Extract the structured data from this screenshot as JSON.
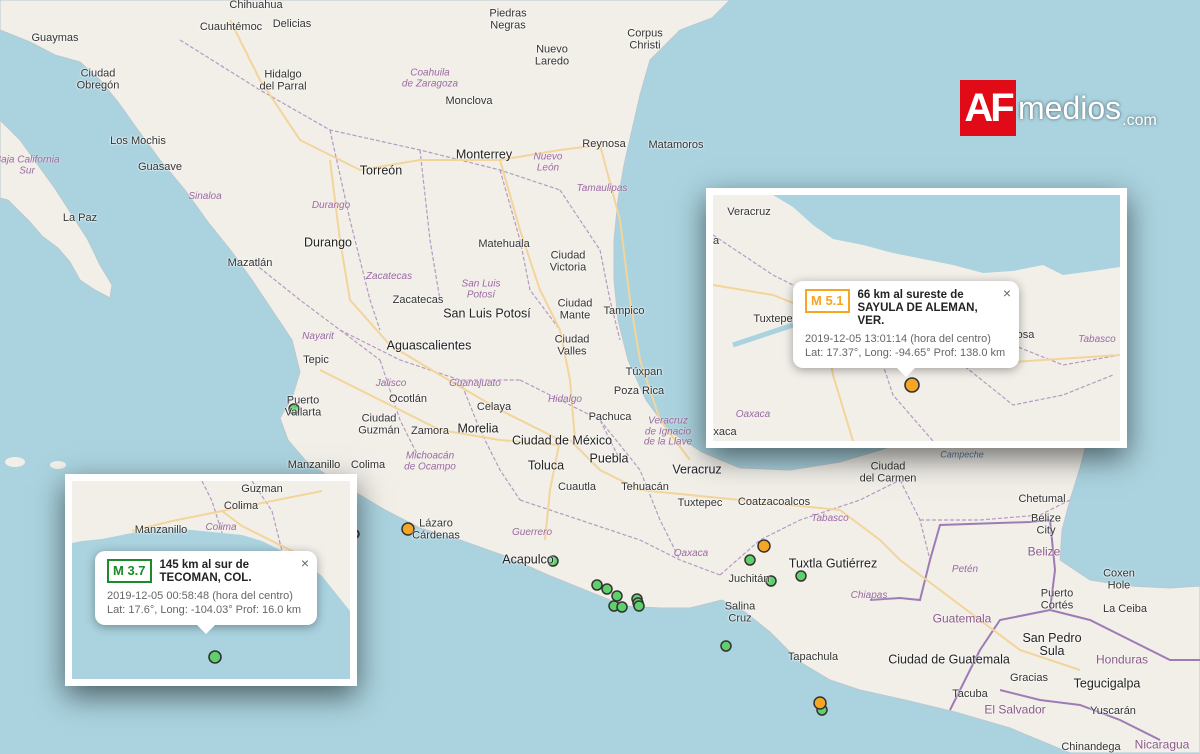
{
  "colors": {
    "water": "#aad3df",
    "land": "#f2efe9",
    "border": "#b49bc2",
    "road": "#f3d49a",
    "quake_green": "#5fd06b",
    "quake_orange": "#f5a623",
    "brand_red": "#e10b17"
  },
  "logo": {
    "box_text": "AF",
    "name": "medios",
    "suffix": ".com"
  },
  "labels": {
    "chihuahua": "Chihuahua",
    "guaymas": "Guaymas",
    "cuauhtemoc": "Cuauhtémoc",
    "delicias": "Delicias",
    "piedras_negras": "Piedras\nNegras",
    "corpus_christi": "Corpus\nChristi",
    "ciudad_obregon": "Ciudad\nObregón",
    "hidalgo_parral": "Hidalgo\ndel Parral",
    "coahuila": "Coahuila\nde Zaragoza",
    "nuevo_laredo": "Nuevo\nLaredo",
    "monclova": "Monclova",
    "los_mochis": "Los Mochis",
    "guasave": "Guasave",
    "baja_california_sur": "Baja California\nSur",
    "torreon": "Torreón",
    "monterrey": "Monterrey",
    "nuevo_leon": "Nuevo\nLeón",
    "reynosa": "Reynosa",
    "matamoros": "Matamoros",
    "sinaloa": "Sinaloa",
    "durango_state": "Durango",
    "tamaulipas": "Tamaulipas",
    "la_paz": "La Paz",
    "durango": "Durango",
    "matehuala": "Matehuala",
    "ciudad_victoria": "Ciudad\nVictoria",
    "mazatlan": "Mazatlán",
    "zacatecas_state": "Zacatecas",
    "san_luis_potosi_state": "San Luis\nPotosí",
    "zacatecas": "Zacatecas",
    "ciudad_mante": "Ciudad\nMante",
    "san_luis_potosi": "San Luis Potosí",
    "tampico": "Tampico",
    "nayarit": "Nayarit",
    "aguascalientes": "Aguascalientes",
    "ciudad_valles": "Ciudad\nValles",
    "tepic": "Tepic",
    "jalisco": "Jalisco",
    "guanajuato": "Guanajuato",
    "tuxpan": "Túxpan",
    "puerto_vallarta": "Puerto\nVallarta",
    "ocotlan": "Ocotlán",
    "hidalgo_state": "Hidalgo",
    "poza_rica": "Poza Rica",
    "celaya": "Celaya",
    "pachuca": "Pachuca",
    "ciudad_guzman": "Ciudad\nGuzmán",
    "zamora": "Zamora",
    "morelia": "Morelia",
    "veracruz_state": "Veracruz\nde Ignacio\nde la Llave",
    "ciudad_de_mexico": "Ciudad de México",
    "manzanillo": "Manzanillo",
    "colima": "Colima",
    "michoacan": "Michoacán\nde Ocampo",
    "toluca": "Toluca",
    "puebla": "Puebla",
    "veracruz": "Veracruz",
    "cuautla": "Cuautla",
    "tehuacan": "Tehuacán",
    "lazaro_cardenas": "Lázaro\nCárdenas",
    "coatzacoalcos": "Coatzacoalcos",
    "tuxtepec": "Tuxtepec",
    "guerrero": "Guerrero",
    "tabasco_state": "Tabasco",
    "acapulco": "Acapulco",
    "oaxaca_state": "Oaxaca",
    "juchitan": "Juchitán",
    "tuxtla_gutierrez": "Tuxtla Gutiérrez",
    "salina_cruz": "Salina\nCruz",
    "chiapas": "Chiapas",
    "tapachula": "Tapachula",
    "ciudad_guatemala": "Ciudad de Guatemala",
    "guatemala": "Guatemala",
    "honduras": "Honduras",
    "campeche": "Campeche",
    "ciudad_del_carmen": "Ciudad\ndel Carmen",
    "chetumal": "Chetumal",
    "belize_city": "Belize\nCity",
    "belize": "Belize",
    "peten": "Petén",
    "coxen_hole": "Coxen\nHole",
    "puerto_cortes": "Puerto\nCortés",
    "la_ceiba": "La Ceiba",
    "san_pedro_sula": "San Pedro\nSula",
    "gracias": "Gracias",
    "tegucigalpa": "Tegucigalpa",
    "tacuba": "Tacuba",
    "el_salvador": "El Salvador",
    "yuscaran": "Yuscarán",
    "nicaragua": "Nicaragua",
    "chinandega": "Chinandega"
  },
  "inset_north": {
    "map_labels": {
      "veracruz": "Veracruz",
      "tuxtepec": "Tuxtepe",
      "hermosa": "hermosa",
      "tabasco": "Tabasco",
      "oaxaca_state": "Oaxaca",
      "oaxaca_city": "xaca",
      "edge": "a"
    },
    "popup": {
      "magnitude": "M 5.1",
      "place_line1": "66 km al sureste de",
      "place_line2": "SAYULA DE ALEMAN, VER.",
      "datetime": "2019-12-05   13:01:14 (hora del centro)",
      "details": "Lat: 17.37°, Long: -94.65°   Prof: 138.0 km",
      "close": "×",
      "badge_color": "#f5a623"
    }
  },
  "inset_south": {
    "map_labels": {
      "guzman": "Guzman",
      "colima_city": "Colima",
      "manzanillo": "Manzanillo",
      "colima_state": "Colima"
    },
    "popup": {
      "magnitude": "M 3.7",
      "place_line1": "145 km al sur de",
      "place_line2": "TECOMAN, COL.",
      "datetime": "2019-12-05   00:58:48 (hora del centro)",
      "details": "Lat: 17.6°, Long: -104.03°   Prof: 16.0 km",
      "close": "×",
      "badge_color": "#1a8a2a"
    }
  },
  "quakes": [
    {
      "mag": "green"
    },
    {
      "mag": "orange"
    },
    {
      "mag": "green"
    },
    {
      "mag": "green"
    },
    {
      "mag": "green"
    },
    {
      "mag": "green"
    },
    {
      "mag": "green"
    },
    {
      "mag": "green"
    },
    {
      "mag": "green"
    },
    {
      "mag": "green"
    },
    {
      "mag": "green"
    },
    {
      "mag": "green"
    },
    {
      "mag": "orange"
    },
    {
      "mag": "green"
    },
    {
      "mag": "green"
    },
    {
      "mag": "green"
    },
    {
      "mag": "green"
    },
    {
      "mag": "orange"
    },
    {
      "mag": "green"
    }
  ]
}
